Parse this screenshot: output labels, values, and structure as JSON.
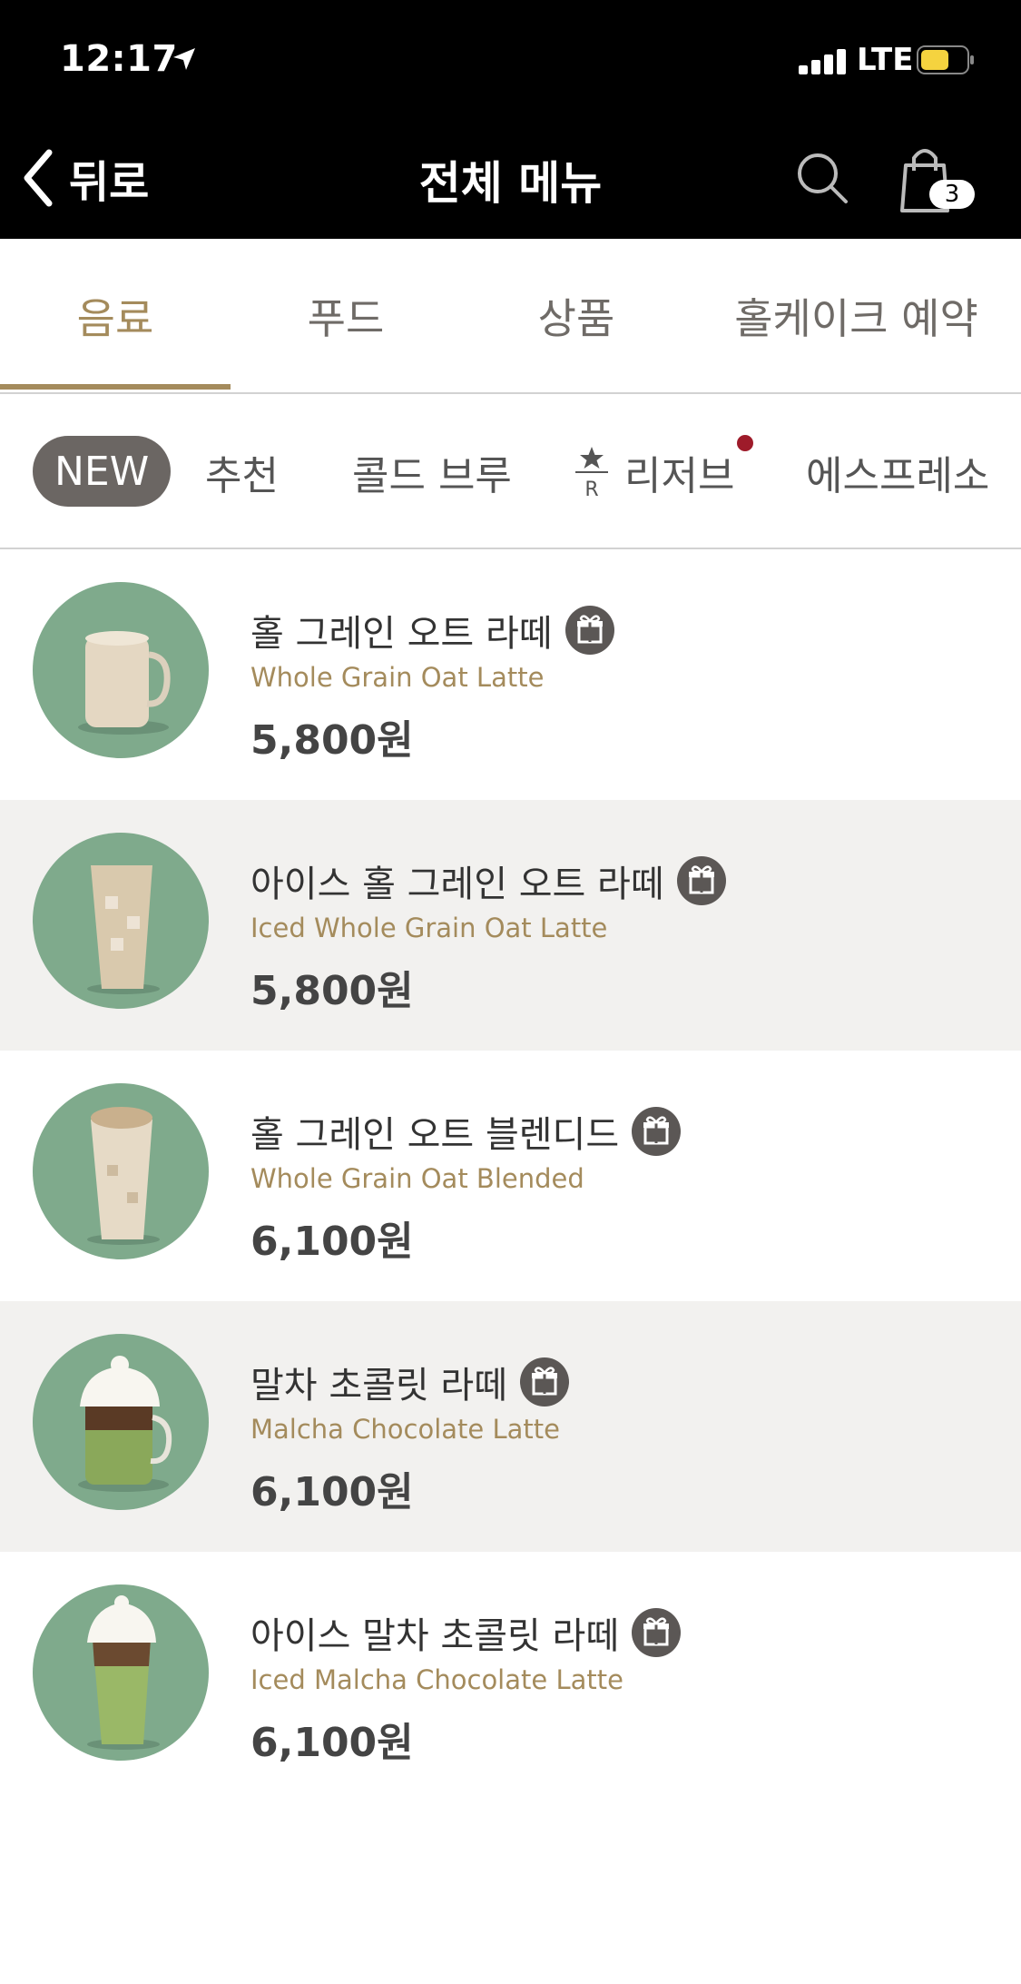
{
  "status": {
    "time": "12:17",
    "network": "LTE"
  },
  "nav": {
    "back_label": "뒤로",
    "title": "전체 메뉴",
    "cart_count": "3"
  },
  "main_tabs": [
    {
      "label": "음료"
    },
    {
      "label": "푸드"
    },
    {
      "label": "상품"
    },
    {
      "label": "홀케이크 예약"
    }
  ],
  "sub_tabs": [
    {
      "label": "NEW"
    },
    {
      "label": "추천"
    },
    {
      "label": "콜드 브루"
    },
    {
      "label": "리저브"
    },
    {
      "label": "에스프레소"
    }
  ],
  "menu": [
    {
      "name": "홀 그레인 오트 라떼",
      "english": "Whole Grain Oat Latte",
      "price": "5,800원"
    },
    {
      "name": "아이스 홀 그레인 오트 라떼",
      "english": "Iced Whole Grain Oat Latte",
      "price": "5,800원"
    },
    {
      "name": "홀 그레인 오트 블렌디드",
      "english": "Whole Grain Oat Blended",
      "price": "6,100원"
    },
    {
      "name": "말차 초콜릿 라떼",
      "english": "Malcha Chocolate Latte",
      "price": "6,100원"
    },
    {
      "name": "아이스 말차 초콜릿 라떼",
      "english": "Iced Malcha Chocolate Latte",
      "price": "6,100원"
    }
  ],
  "colors": {
    "accent": "#a48b5c",
    "thumb_bg": "#7faa8c",
    "alt_row": "#f2f1ef",
    "badge": "#5b5755",
    "notification": "#9e1b2a"
  }
}
